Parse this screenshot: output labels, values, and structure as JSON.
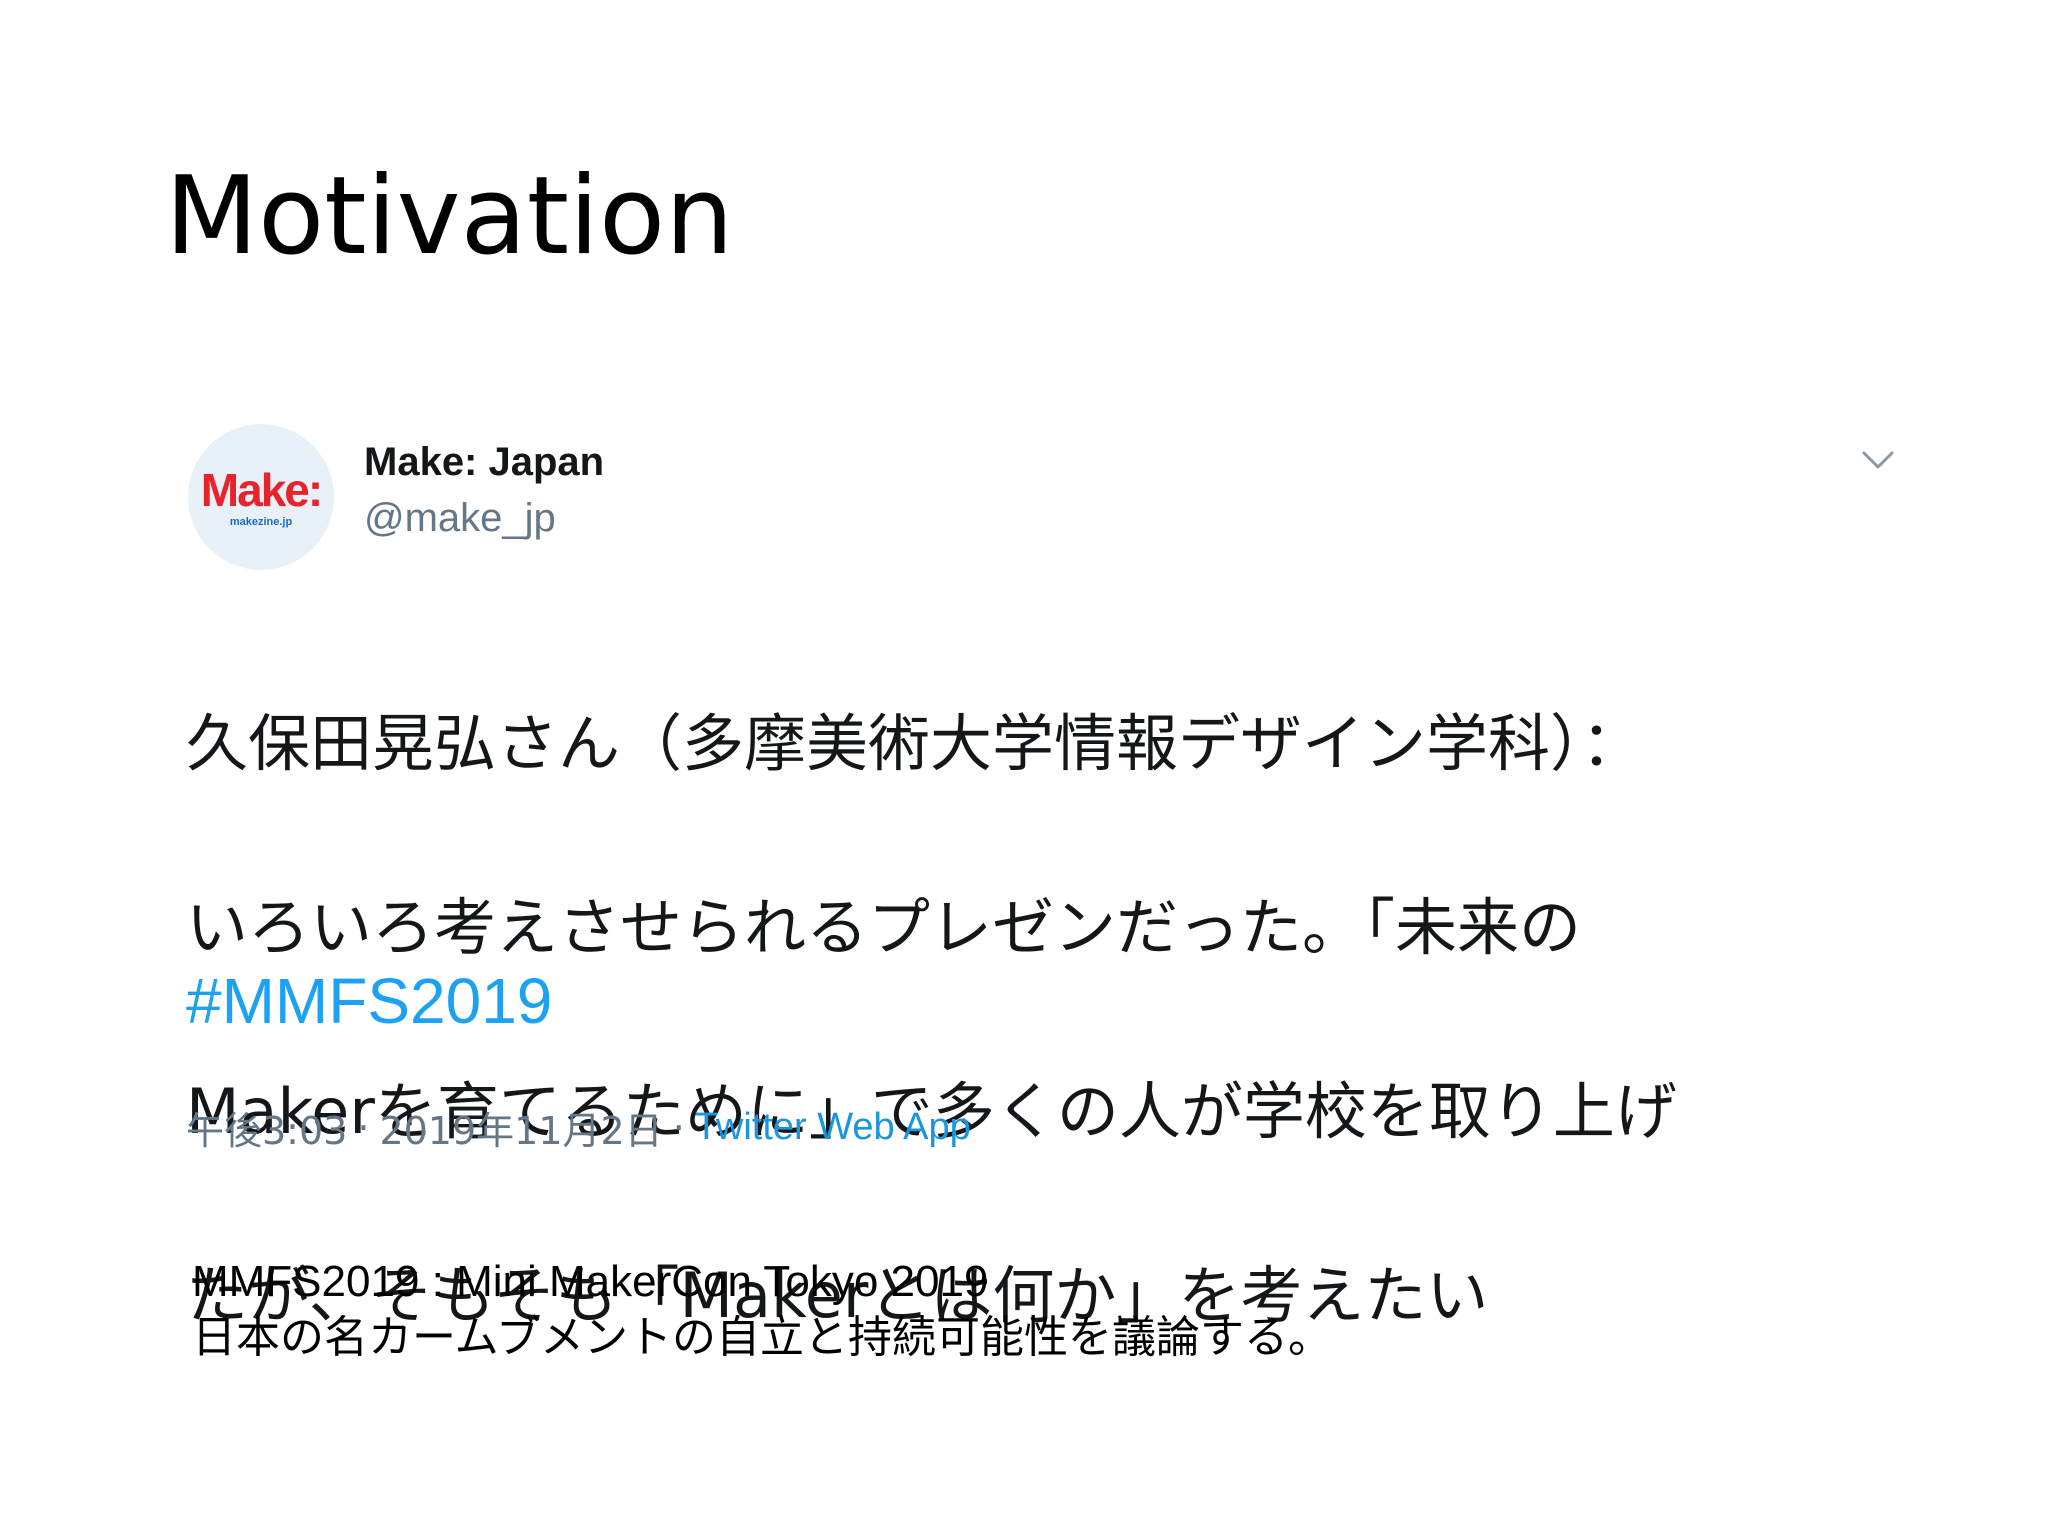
{
  "slide": {
    "title": "Motivation"
  },
  "tweet": {
    "avatar": {
      "brand": "Make:",
      "sub": "makezine.jp"
    },
    "user_name": "Make: Japan",
    "user_handle": "@make_jp",
    "text_lines": [
      "久保田晃弘さん（多摩美術大学情報デザイン学科）：",
      "いろいろ考えさせられるプレゼンだった。「未来の",
      "Makerを育てるために」で多くの人が学校を取り上げ",
      "たが、そもそも「Makerとは何か」を考えたい"
    ],
    "hashtag": "#MMFS2019",
    "time": "午後3:03",
    "date": "2019年11月2日",
    "separator": "·",
    "source": "Twitter Web App",
    "colors": {
      "hashtag": "#1da1f2",
      "source": "#1b95e0",
      "handle": "#657786",
      "brand": "#e8232b"
    },
    "icons": {
      "menu": "chevron-down-icon"
    }
  },
  "caption": {
    "line1": "MMFS2019 : Mini MakerCon Tokyo 2019",
    "line2": "日本の名カームブメントの自立と持続可能性を議論する。"
  }
}
